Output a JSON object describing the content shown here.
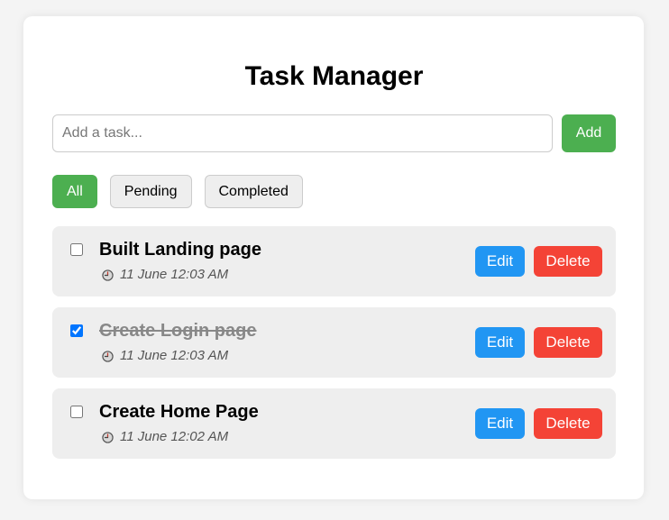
{
  "app": {
    "title": "Task Manager"
  },
  "input": {
    "placeholder": "Add a task...",
    "value": "",
    "add_label": "Add"
  },
  "filters": [
    {
      "label": "All",
      "active": true
    },
    {
      "label": "Pending",
      "active": false
    },
    {
      "label": "Completed",
      "active": false
    }
  ],
  "tasks": [
    {
      "title": "Built Landing page",
      "time": "11 June 12:03 AM",
      "completed": false,
      "edit_label": "Edit",
      "delete_label": "Delete"
    },
    {
      "title": "Create Login page",
      "time": "11 June 12:03 AM",
      "completed": true,
      "edit_label": "Edit",
      "delete_label": "Delete"
    },
    {
      "title": "Create Home Page",
      "time": "11 June 12:02 AM",
      "completed": false,
      "edit_label": "Edit",
      "delete_label": "Delete"
    }
  ],
  "icons": {
    "timestamp": "clock-icon"
  },
  "colors": {
    "accent_green": "#4caf50",
    "edit_blue": "#2196f3",
    "delete_red": "#f44336",
    "task_bg": "#eeeeee"
  }
}
